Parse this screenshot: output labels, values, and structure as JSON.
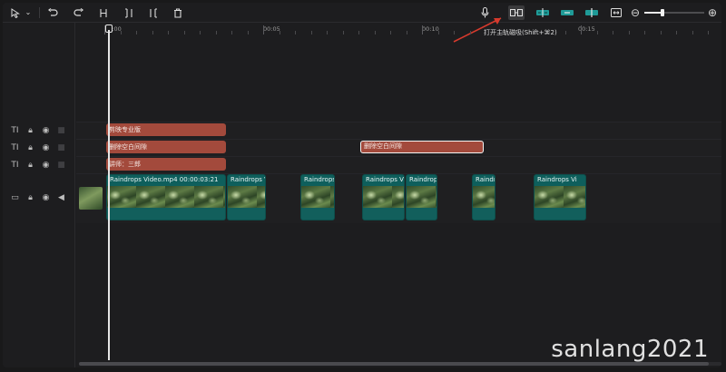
{
  "toolbar": {
    "select_icon": "cursor-arrow-icon",
    "undo_icon": "undo-icon",
    "redo_icon": "redo-icon",
    "split_icon": "split-icon",
    "split_left_icon": "split-left-icon",
    "split_right_icon": "split-right-icon",
    "delete_icon": "trash-icon",
    "mic_icon": "microphone-icon",
    "main_track_magnet_icon": "main-track-magnet-icon",
    "zoom_minus": "⊖",
    "zoom_plus": "⊕",
    "zoom_level_fraction": 0.3
  },
  "tooltip": {
    "text": "打开主轨磁吸(Shift+⌘2)"
  },
  "ruler": {
    "labels": [
      "00:00",
      "00:05",
      "00:10",
      "00:15"
    ]
  },
  "tracks": {
    "text_rows": [
      {
        "clips": [
          {
            "label": "剪映专业版"
          }
        ]
      },
      {
        "clips": [
          {
            "label": "删除空白间隙"
          },
          {
            "label": "删除空白间隙",
            "selected": true
          }
        ]
      },
      {
        "clips": [
          {
            "label": "讲师：三郎"
          }
        ]
      }
    ],
    "video_clips": [
      {
        "title": "Raindrops Video.mp4   00:00:03:21"
      },
      {
        "title": "Raindrops Vi"
      },
      {
        "title": "Raindrops"
      },
      {
        "title": "Raindrops Vi"
      },
      {
        "title": "Raindrops"
      },
      {
        "title": "Raindr"
      },
      {
        "title": "Raindrops Vi"
      }
    ]
  },
  "headers": {
    "text_icon": "TI",
    "lock_icon": "lock-icon",
    "eye_icon": "eye-icon",
    "video_icon": "video-icon",
    "speaker_icon": "speaker-icon"
  },
  "watermark": "sanlang2021"
}
